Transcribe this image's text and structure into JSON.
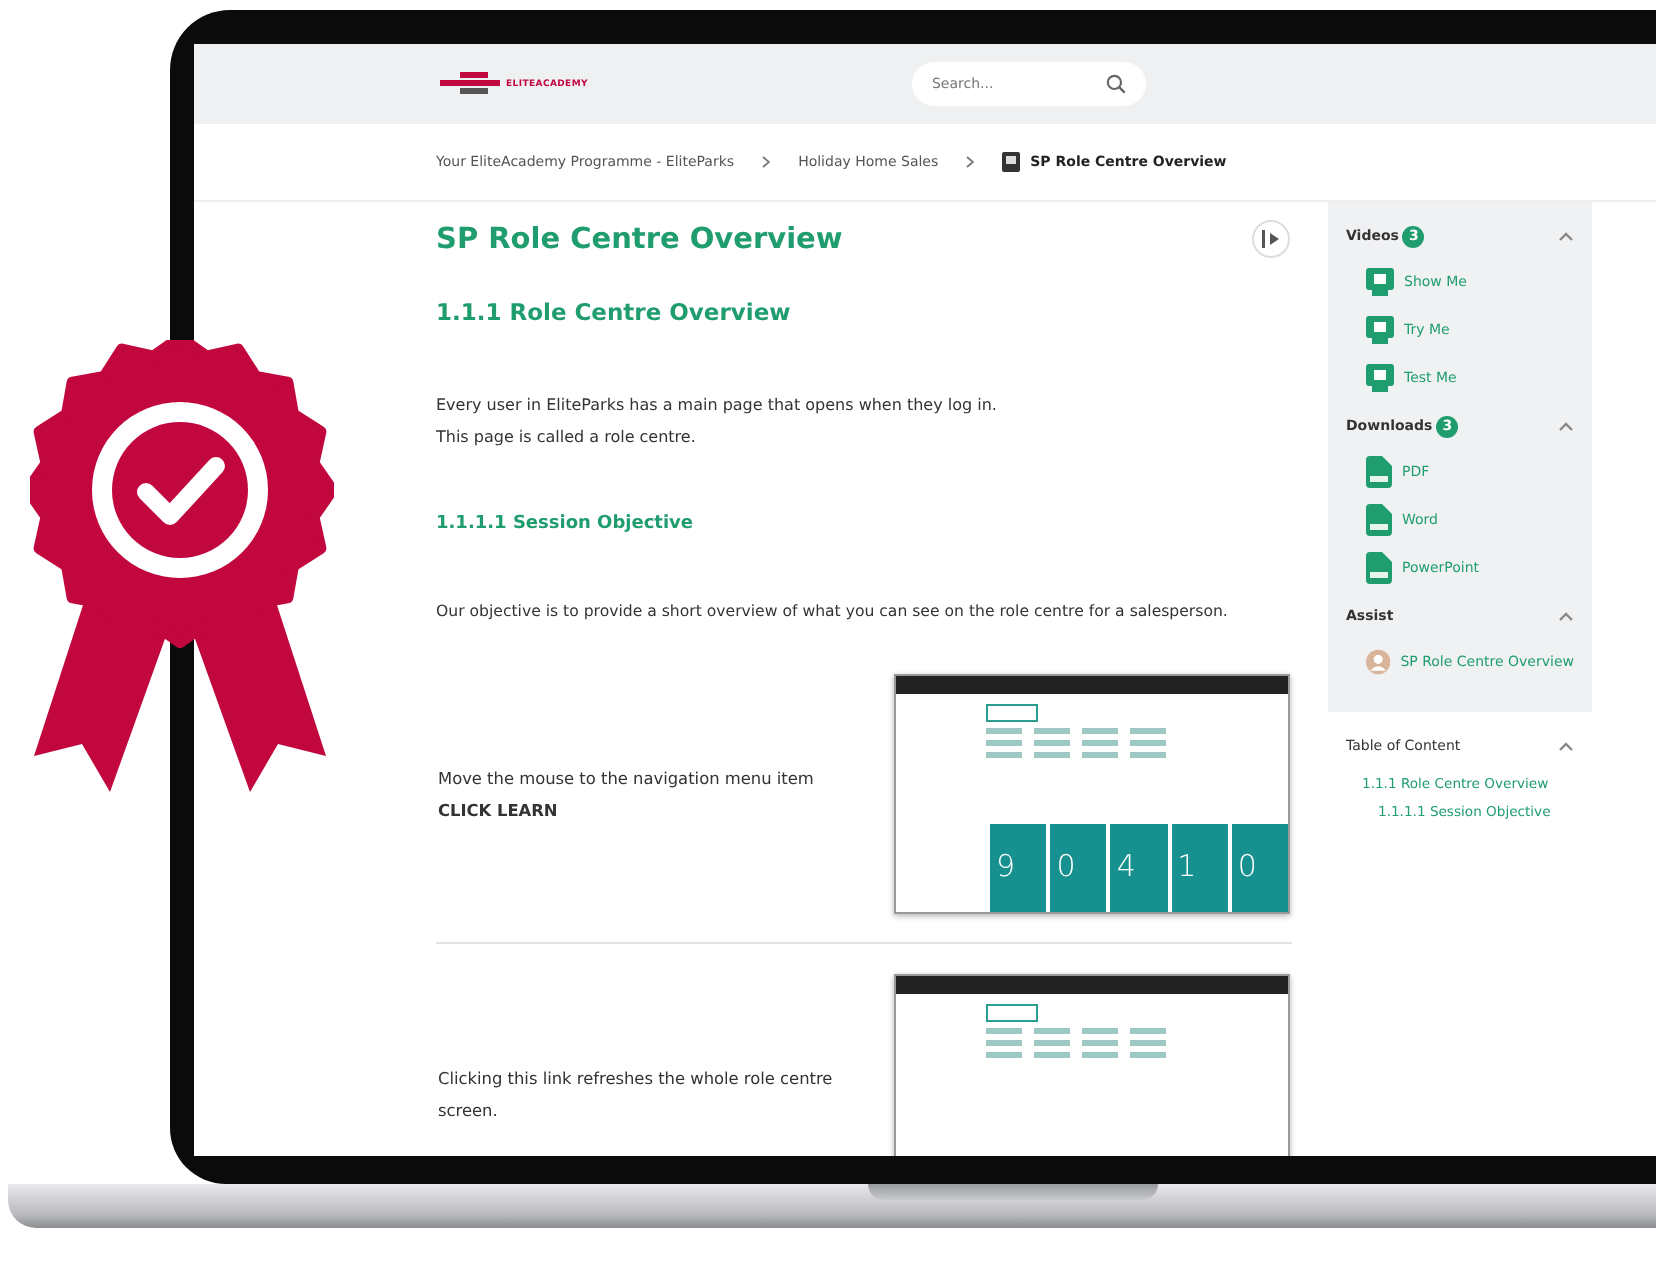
{
  "header": {
    "logo_text": "ELITEACADEMY",
    "search": {
      "placeholder": "Search..."
    }
  },
  "breadcrumb": [
    {
      "label": "Your EliteAcademy Programme - EliteParks",
      "current": false
    },
    {
      "label": "Holiday Home Sales",
      "current": false
    },
    {
      "label": "SP Role Centre Overview",
      "current": true
    }
  ],
  "content": {
    "title": "SP Role Centre Overview",
    "heading": "1.1.1 Role Centre Overview",
    "intro": "Every user in EliteParks has a main page that opens when they log in.\nThis page is called a role centre.",
    "subheading": "1.1.1.1 Session Objective",
    "objective": "Our objective is to provide a short overview of what you can see on the role centre for a salesperson.",
    "steps": [
      {
        "text": "Move the mouse to the navigation menu item\n**CLICK LEARN**",
        "tiles": [
          "9",
          "0",
          "4",
          "1",
          "0"
        ]
      },
      {
        "text": "Clicking this link refreshes the whole role centre screen."
      }
    ]
  },
  "sidebar": {
    "sections": [
      {
        "title": "Videos",
        "count": "3",
        "expanded": true,
        "items": [
          {
            "kind": "video",
            "label": "Show Me"
          },
          {
            "kind": "video",
            "label": "Try Me"
          },
          {
            "kind": "video",
            "label": "Test Me"
          }
        ]
      },
      {
        "title": "Downloads",
        "count": "3",
        "expanded": true,
        "items": [
          {
            "kind": "file",
            "label": "PDF"
          },
          {
            "kind": "file",
            "label": "Word"
          },
          {
            "kind": "file",
            "label": "PowerPoint"
          }
        ]
      },
      {
        "title": "Assist",
        "expanded": true,
        "items": [
          {
            "kind": "avatar",
            "label": "SP Role Centre Overview"
          }
        ]
      }
    ],
    "toc": {
      "title": "Table of Content",
      "expanded": true,
      "items": [
        {
          "label": "1.1.1 Role Centre Overview",
          "children": [
            {
              "label": "1.1.1.1 Session Objective"
            }
          ]
        }
      ]
    }
  }
}
